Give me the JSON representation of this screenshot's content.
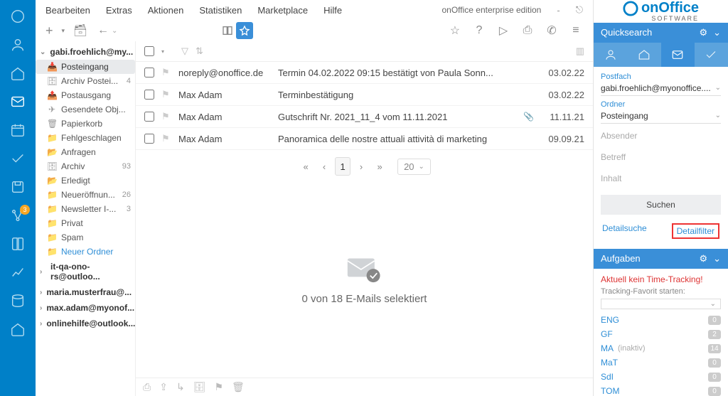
{
  "rail_badge": "3",
  "menu": [
    "Bearbeiten",
    "Extras",
    "Aktionen",
    "Statistiken",
    "Marketplace",
    "Hilfe"
  ],
  "edition": "onOffice enterprise edition",
  "accounts": [
    {
      "name": "gabi.froehlich@my...",
      "open": true
    },
    {
      "name": "it-qa-ono-rs@outloo..."
    },
    {
      "name": "maria.musterfrau@..."
    },
    {
      "name": "max.adam@myonof..."
    },
    {
      "name": "onlinehilfe@outlook..."
    }
  ],
  "folders": [
    {
      "icon": "📥",
      "name": "Posteingang",
      "sel": true
    },
    {
      "icon": "🗄",
      "name": "Archiv Postei...",
      "count": "4"
    },
    {
      "icon": "📤",
      "name": "Postausgang"
    },
    {
      "icon": "✈",
      "name": "Gesendete Obj..."
    },
    {
      "icon": "🗑",
      "name": "Papierkorb"
    },
    {
      "icon": "📁",
      "name": "Fehlgeschlagen"
    },
    {
      "icon": "📂",
      "name": "Anfragen"
    },
    {
      "icon": "🗄",
      "name": "Archiv",
      "count": "93"
    },
    {
      "icon": "📂",
      "name": "Erledigt"
    },
    {
      "icon": "📁",
      "name": "Neueröffnun...",
      "count": "26"
    },
    {
      "icon": "📁",
      "name": "Newsletter I-...",
      "count": "3"
    },
    {
      "icon": "📁",
      "name": "Privat"
    },
    {
      "icon": "📁",
      "name": "Spam"
    },
    {
      "icon": "📁",
      "name": "Neuer Ordner",
      "new": true
    }
  ],
  "emails": [
    {
      "from": "noreply@onoffice.de",
      "subj": "Termin 04.02.2022 09:15 bestätigt von Paula Sonn...",
      "date": "03.02.22"
    },
    {
      "from": "Max Adam",
      "subj": "Terminbestätigung",
      "date": "03.02.22"
    },
    {
      "from": "Max Adam",
      "subj": "Gutschrift Nr. 2021_11_4 vom 11.11.2021",
      "attach": true,
      "date": "11.11.21"
    },
    {
      "from": "Max Adam",
      "subj": "Panoramica delle nostre attuali attività di marketing",
      "date": "09.09.21"
    }
  ],
  "page_size": "20",
  "empty": "0 von 18 E-Mails selektiert",
  "side": {
    "logo_main": "onOffice",
    "logo_sub": "SOFTWARE",
    "quicksearch": "Quicksearch",
    "postfach_label": "Postfach",
    "postfach_value": "gabi.froehlich@myonoffice....",
    "ordner_label": "Ordner",
    "ordner_value": "Posteingang",
    "absender": "Absender",
    "betreff": "Betreff",
    "inhalt": "Inhalt",
    "suchen": "Suchen",
    "detailsuche": "Detailsuche",
    "detailfilter": "Detailfilter",
    "aufgaben": "Aufgaben",
    "notrack": "Aktuell kein Time-Tracking!",
    "tflabel": "Tracking-Favorit starten:",
    "tags": [
      {
        "n": "ENG",
        "c": "0"
      },
      {
        "n": "GF",
        "c": "2"
      },
      {
        "n": "MA",
        "i": "(inaktiv)",
        "c": "14"
      },
      {
        "n": "MaT",
        "c": "0"
      },
      {
        "n": "SdI",
        "c": "0"
      },
      {
        "n": "TOM",
        "c": "0"
      }
    ]
  }
}
